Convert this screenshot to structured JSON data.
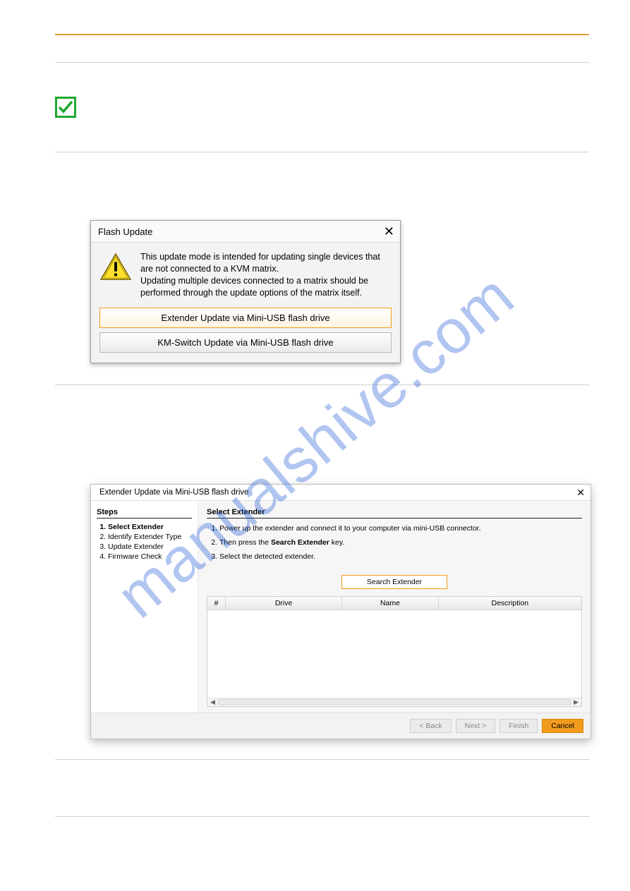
{
  "watermark_text": "manualshive.com",
  "flash_dialog": {
    "title": "Flash Update",
    "warning_text": "This update mode is intended for updating single devices that are not connected to a KVM matrix.\nUpdating multiple devices connected to a matrix should be performed through the update options of the matrix itself.",
    "btn_primary": "Extender Update via Mini-USB flash drive",
    "btn_secondary": "KM-Switch Update via Mini-USB flash drive"
  },
  "wizard": {
    "window_title": "Extender Update via Mini-USB flash drive",
    "steps_header": "Steps",
    "steps": [
      "Select Extender",
      "Identify Extender Type",
      "Update Extender",
      "Firmware Check"
    ],
    "main_header": "Select Extender",
    "instructions": [
      "Power up the extender and connect it to your computer via mini-USB connector.",
      "Then press the Search Extender key.",
      "Select the detected extender."
    ],
    "instr2_prefix": "Then press the ",
    "instr2_bold": "Search Extender",
    "instr2_suffix": " key.",
    "search_btn": "Search Extender",
    "table": {
      "col_hash": "#",
      "col_drive": "Drive",
      "col_name": "Name",
      "col_desc": "Description"
    },
    "buttons": {
      "back": "< Back",
      "next": "Next >",
      "finish": "Finish",
      "cancel": "Cancel"
    }
  }
}
